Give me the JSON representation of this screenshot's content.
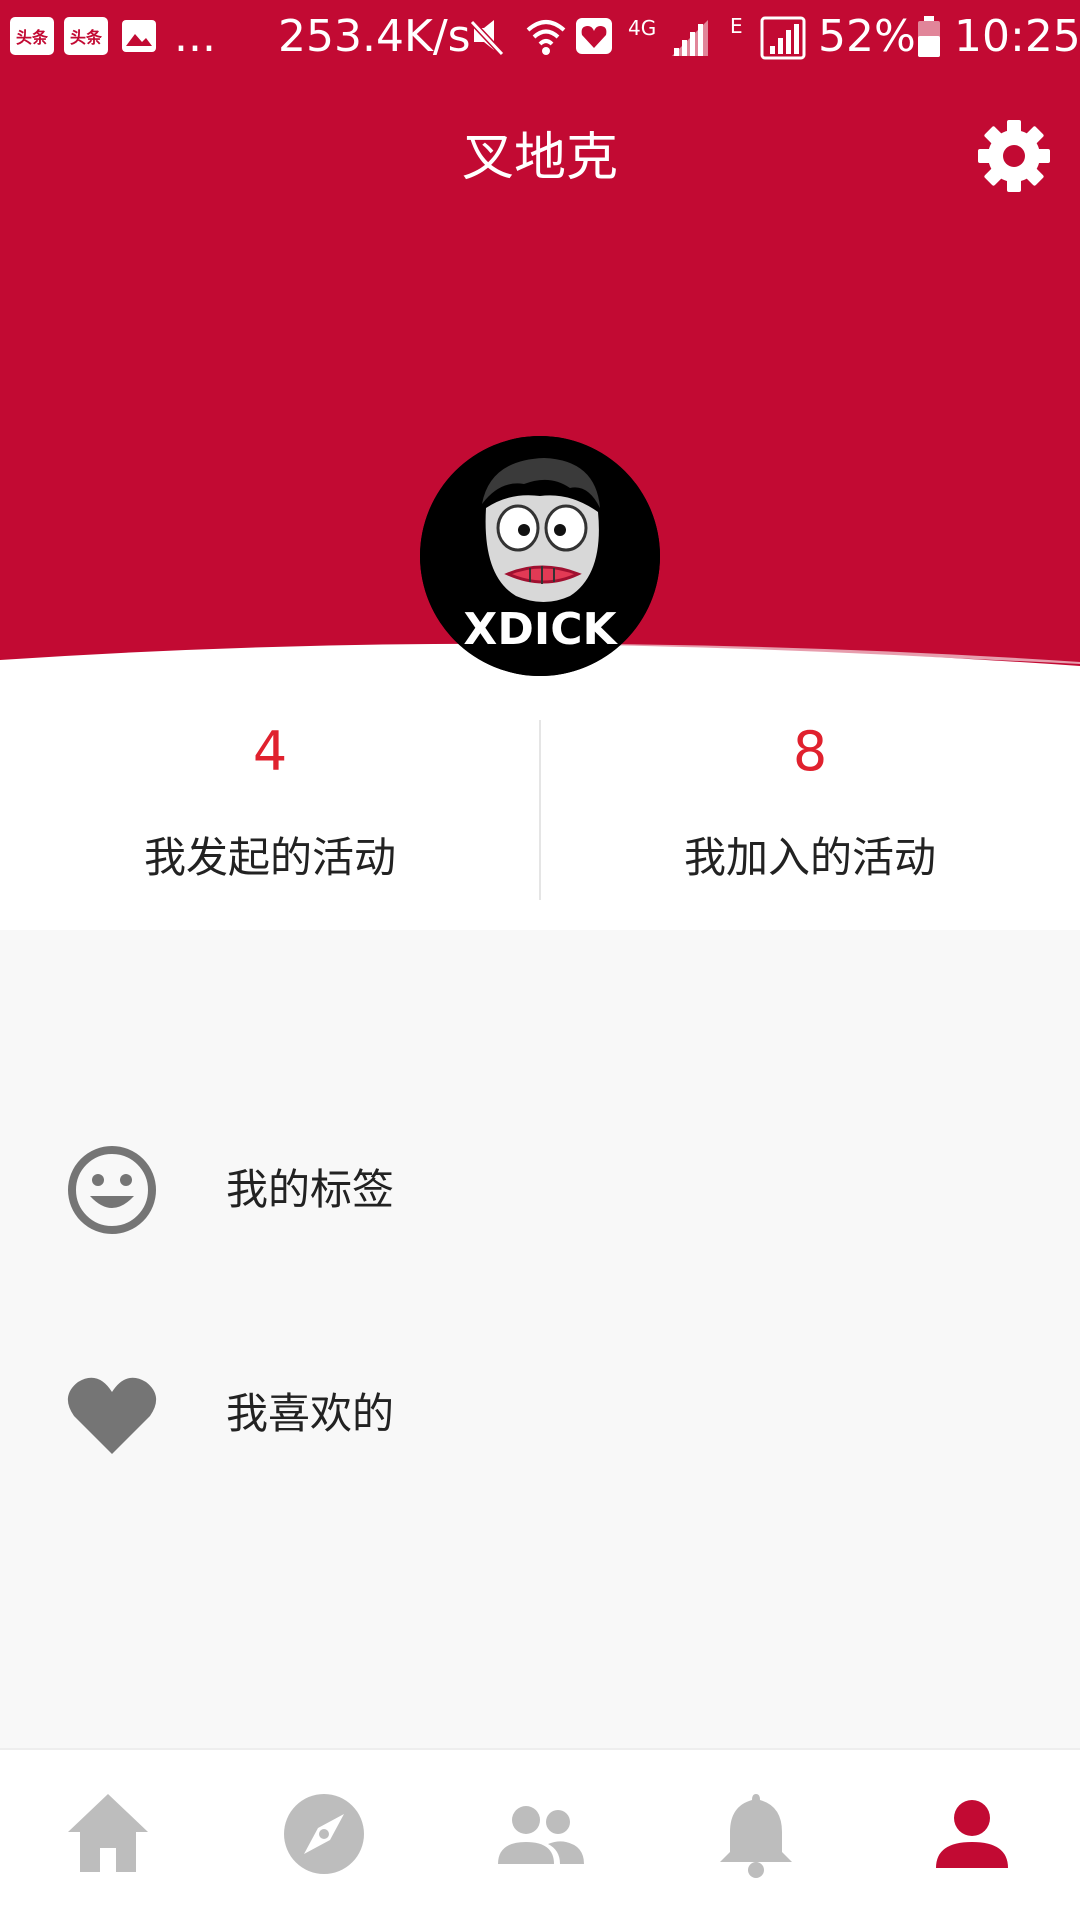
{
  "status_bar": {
    "app_icon_1": "头条",
    "app_icon_2": "头条",
    "more": "...",
    "speed": "253.4K/s",
    "network_4g": "4G",
    "network_e": "E",
    "battery": "52%",
    "time": "10:25",
    "icons": [
      "gallery-icon",
      "mute-icon",
      "wifi-icon",
      "heart-app-icon",
      "signal-icon",
      "battery-icon"
    ]
  },
  "header": {
    "title": "叉地克",
    "settings_icon": "gear-icon",
    "background_color": "#c20a33"
  },
  "profile": {
    "avatar_text": "XDICK"
  },
  "stats": [
    {
      "value": "4",
      "label": "我发起的活动"
    },
    {
      "value": "8",
      "label": "我加入的活动"
    }
  ],
  "menu": [
    {
      "icon": "smiley-icon",
      "label": "我的标签"
    },
    {
      "icon": "heart-icon",
      "label": "我喜欢的"
    }
  ],
  "tabbar": {
    "tabs": [
      {
        "icon": "home-icon",
        "active": false
      },
      {
        "icon": "compass-icon",
        "active": false
      },
      {
        "icon": "people-icon",
        "active": false
      },
      {
        "icon": "bell-icon",
        "active": false
      },
      {
        "icon": "person-icon",
        "active": true
      }
    ],
    "active_color": "#c20a33",
    "inactive_color": "#bdbdbd"
  }
}
